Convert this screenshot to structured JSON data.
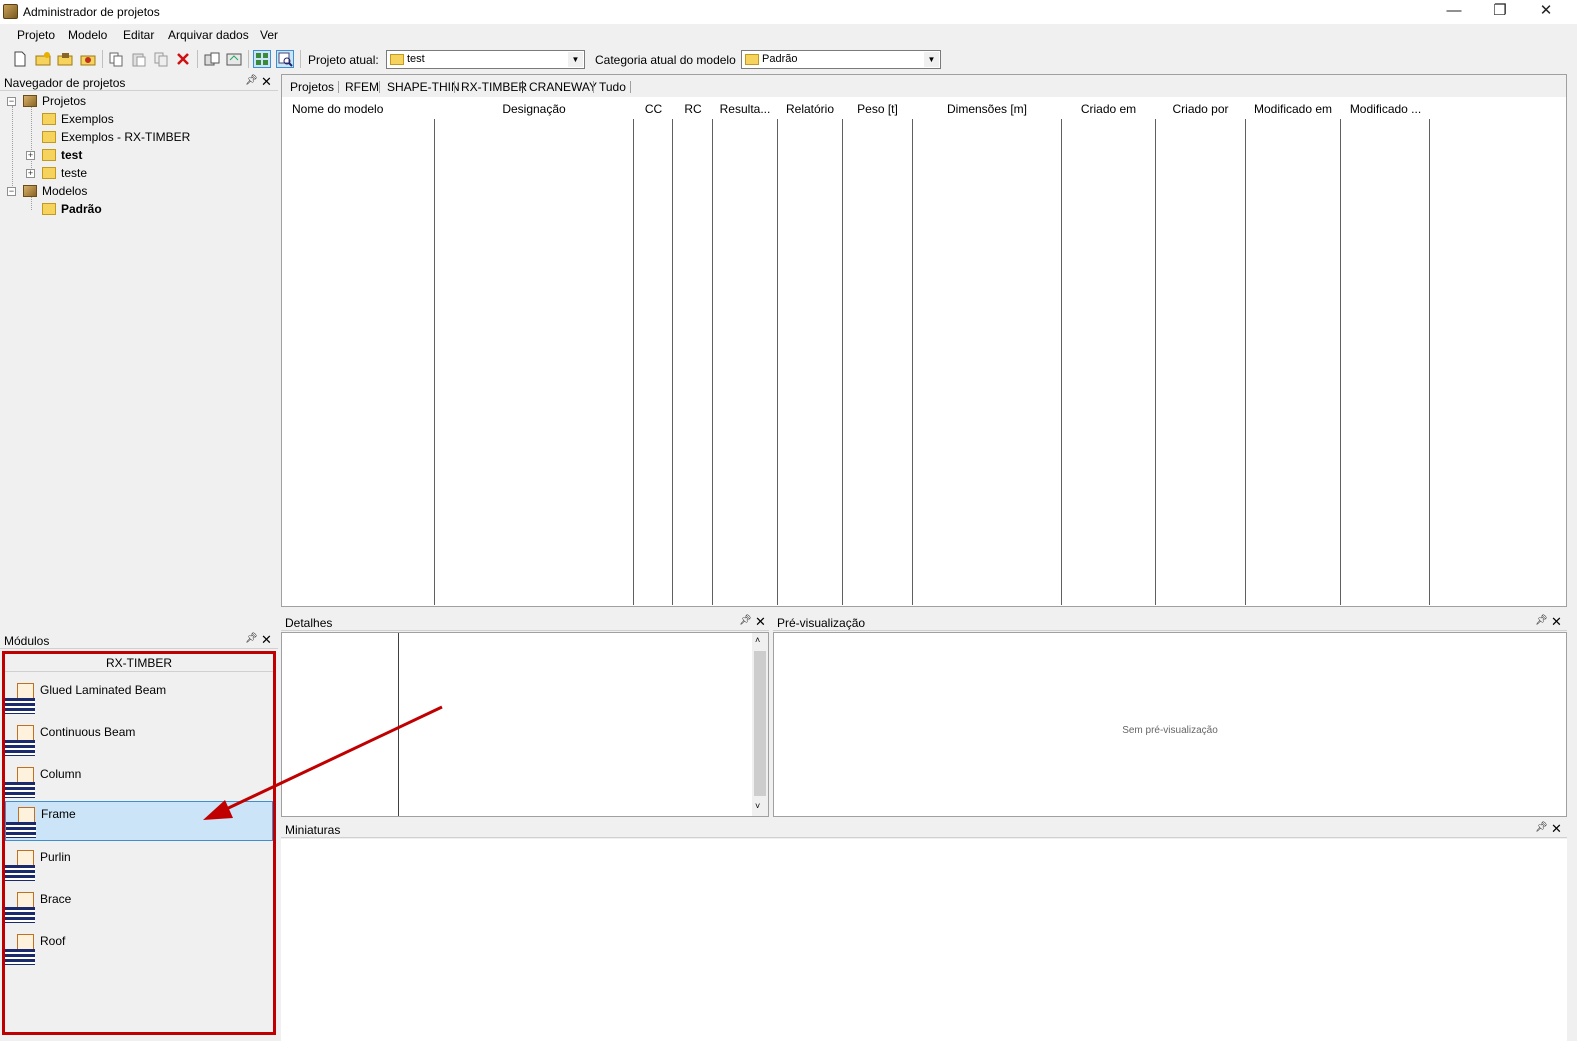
{
  "window": {
    "title": "Administrador de projetos"
  },
  "menu": {
    "items": [
      "Projeto",
      "Modelo",
      "Editar",
      "Arquivar dados",
      "Ver"
    ]
  },
  "toolbar": {
    "project_label": "Projeto atual:",
    "project_value": "test",
    "category_label": "Categoria atual do modelo",
    "category_value": "Padrão"
  },
  "navigator": {
    "title": "Navegador de projetos",
    "tree": [
      {
        "label": "Projetos",
        "icon": "box-icon",
        "bold": false
      },
      {
        "label": "Exemplos",
        "icon": "folder-icon",
        "bold": false
      },
      {
        "label": "Exemplos - RX-TIMBER",
        "icon": "folder-icon",
        "bold": false
      },
      {
        "label": "test",
        "icon": "folder-icon",
        "bold": true
      },
      {
        "label": "teste",
        "icon": "folder-icon",
        "bold": false
      },
      {
        "label": "Modelos",
        "icon": "box-icon",
        "bold": false
      },
      {
        "label": "Padrão",
        "icon": "folder-icon",
        "bold": true
      }
    ]
  },
  "main": {
    "tabs": [
      "Projetos",
      "RFEM",
      "SHAPE-THIN",
      "RX-TIMBER",
      "CRANEWAY",
      "Tudo"
    ],
    "active_tab": "RX-TIMBER",
    "columns": [
      "Nome do modelo",
      "Designação",
      "CC",
      "RC",
      "Resulta...",
      "Relatório",
      "Peso [t]",
      "Dimensões [m]",
      "Criado em",
      "Criado por",
      "Modificado em",
      "Modificado ..."
    ]
  },
  "details": {
    "title": "Detalhes"
  },
  "preview": {
    "title": "Pré-visualização",
    "empty_text": "Sem pré-visualização"
  },
  "thumbnails": {
    "title": "Miniaturas"
  },
  "modules": {
    "title": "Módulos",
    "group": "RX-TIMBER",
    "items": [
      "Glued Laminated Beam",
      "Continuous Beam",
      "Column",
      "Frame",
      "Purlin",
      "Brace",
      "Roof"
    ],
    "selected": "Frame"
  },
  "colors": {
    "highlight": "#c00000",
    "selection": "#cce4f7"
  }
}
